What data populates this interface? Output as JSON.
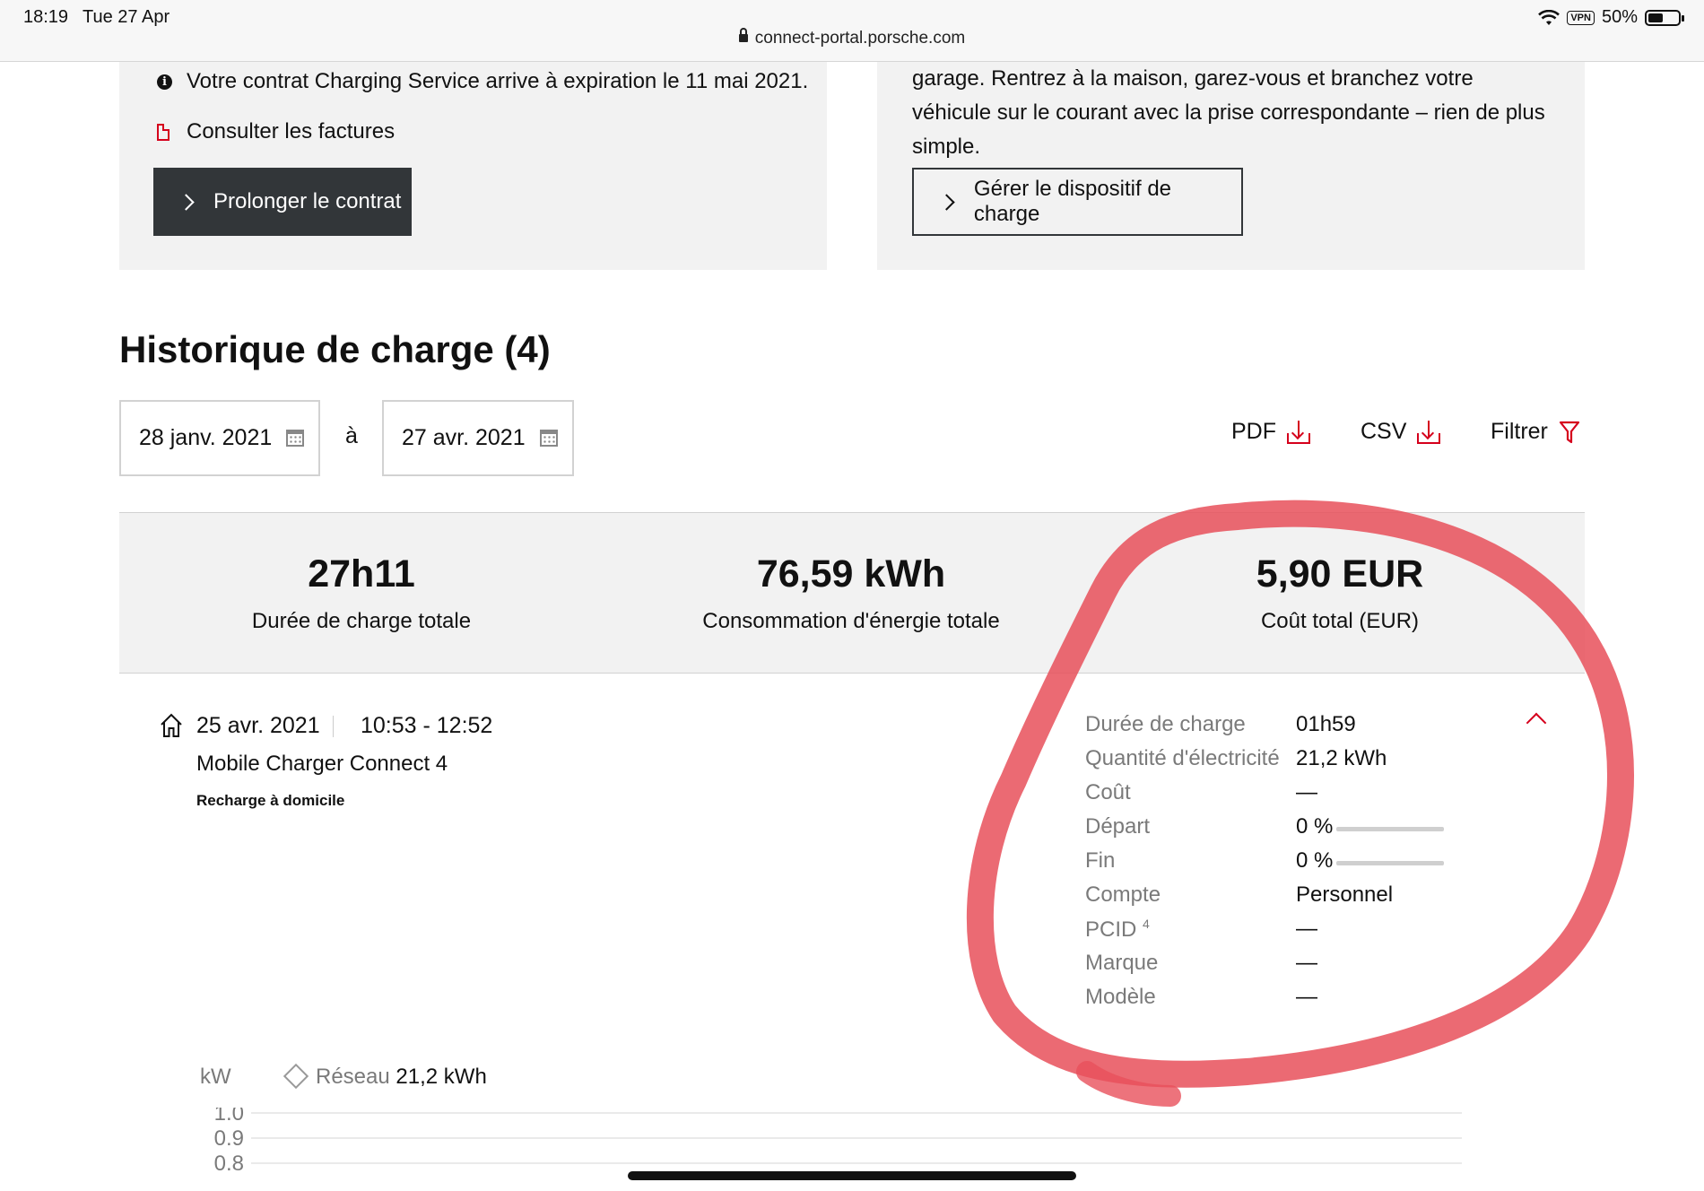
{
  "status_bar": {
    "time": "18:19",
    "date": "Tue 27 Apr",
    "vpn": "VPN",
    "battery": "50%",
    "battery_level": 0.5
  },
  "browser": {
    "url": "connect-portal.porsche.com"
  },
  "card_left": {
    "contract_notice": "Votre contrat Charging Service arrive à expiration le 11 mai 2021.",
    "invoices_link": "Consulter les factures",
    "extend_button": "Prolonger le contrat"
  },
  "card_right": {
    "text": "garage. Rentrez à la maison, garez-vous et branchez votre véhicule sur le courant avec la prise correspondante – rien de plus simple.",
    "manage_button": "Gérer le dispositif de charge"
  },
  "history": {
    "title": "Historique de charge (4)",
    "date_from": "28 janv. 2021",
    "date_sep": "à",
    "date_to": "27 avr. 2021",
    "pdf": "PDF",
    "csv": "CSV",
    "filter": "Filtrer"
  },
  "summary": {
    "duration_value": "27h11",
    "duration_label": "Durée de charge totale",
    "energy_value": "76,59 kWh",
    "energy_label": "Consommation d'énergie totale",
    "cost_value": "5,90 EUR",
    "cost_label": "Coût total (EUR)"
  },
  "session": {
    "date": "25 avr. 2021",
    "time": "10:53 - 12:52",
    "device": "Mobile Charger Connect 4",
    "type": "Recharge à domicile",
    "details": [
      {
        "label": "Durée de charge",
        "value": "01h59"
      },
      {
        "label": "Quantité d'électricité",
        "value": "21,2 kWh"
      },
      {
        "label": "Coût",
        "value": "—"
      },
      {
        "label": "Départ",
        "value": "0 %",
        "level": 0
      },
      {
        "label": "Fin",
        "value": "0 %",
        "level": 0
      },
      {
        "label": "Compte",
        "value": "Personnel"
      },
      {
        "label": "PCID",
        "sup": "4",
        "value": "—"
      },
      {
        "label": "Marque",
        "value": "—"
      },
      {
        "label": "Modèle",
        "value": "—"
      }
    ]
  },
  "chart_data": {
    "type": "line",
    "ylabel": "kW",
    "legend": [
      {
        "name": "Réseau",
        "value": "21,2 kWh"
      }
    ],
    "y_ticks": [
      "1.0",
      "0.9",
      "0.8"
    ],
    "ylim": [
      0.8,
      1.0
    ],
    "series": [
      {
        "name": "Réseau",
        "values": []
      }
    ],
    "grid": true
  },
  "colors": {
    "accent": "#d5001c",
    "dark_button": "#323639",
    "panel": "#f2f2f2",
    "annotation": "#e8505b"
  }
}
